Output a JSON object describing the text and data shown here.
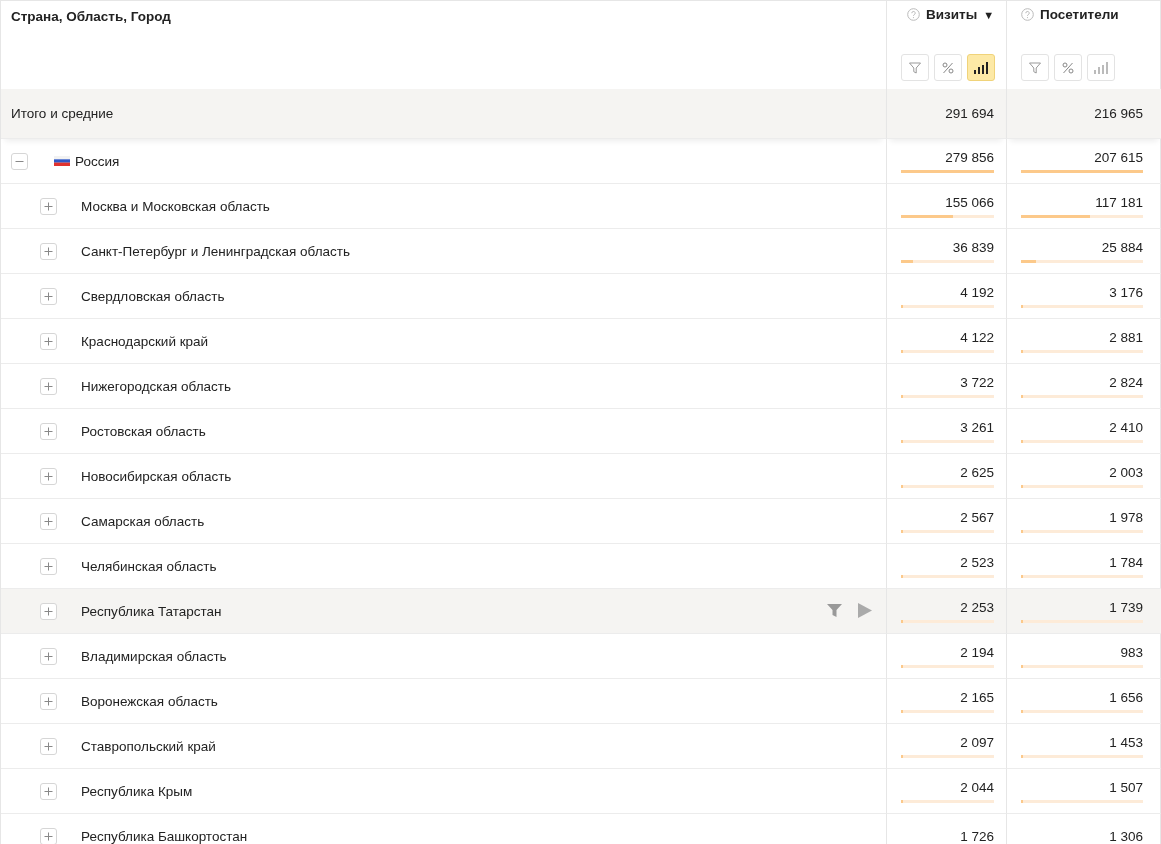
{
  "table": {
    "dimension_header": "Страна, Область, Город",
    "columns": [
      {
        "label": "Визиты",
        "sort_indicator": "▼",
        "tools": [
          {
            "kind": "filter",
            "selected": false
          },
          {
            "kind": "percent",
            "selected": false
          },
          {
            "kind": "bars",
            "selected": true
          }
        ]
      },
      {
        "label": "Посетители",
        "tools": [
          {
            "kind": "filter",
            "selected": false
          },
          {
            "kind": "percent",
            "selected": false
          },
          {
            "kind": "bars",
            "selected": false
          }
        ]
      }
    ],
    "totals": {
      "label": "Итого и средние",
      "values": [
        "291 694",
        "216 965"
      ]
    },
    "rows": [
      {
        "name": "Россия",
        "flag": true,
        "expanded": true,
        "hovered": false,
        "values": [
          {
            "text": "279 856",
            "level": 1
          },
          {
            "text": "207 615",
            "level": 1
          }
        ],
        "children": [
          {
            "name": "Москва и Московская область",
            "expanded": false,
            "hovered": false,
            "values": [
              {
                "text": "155 066",
                "level": 0.554
              },
              {
                "text": "117 181",
                "level": 0.564
              }
            ]
          },
          {
            "name": "Санкт-Петербург и Ленинградская область",
            "expanded": false,
            "hovered": false,
            "values": [
              {
                "text": "36 839",
                "level": 0.132
              },
              {
                "text": "25 884",
                "level": 0.125
              }
            ]
          },
          {
            "name": "Свердловская область",
            "expanded": false,
            "hovered": false,
            "values": [
              {
                "text": "4 192",
                "level": 0.015
              },
              {
                "text": "3 176",
                "level": 0.015
              }
            ]
          },
          {
            "name": "Краснодарский край",
            "expanded": false,
            "hovered": false,
            "values": [
              {
                "text": "4 122",
                "level": 0.015
              },
              {
                "text": "2 881",
                "level": 0.014
              }
            ]
          },
          {
            "name": "Нижегородская область",
            "expanded": false,
            "hovered": false,
            "values": [
              {
                "text": "3 722",
                "level": 0.013
              },
              {
                "text": "2 824",
                "level": 0.014
              }
            ]
          },
          {
            "name": "Ростовская область",
            "expanded": false,
            "hovered": false,
            "values": [
              {
                "text": "3 261",
                "level": 0.012
              },
              {
                "text": "2 410",
                "level": 0.012
              }
            ]
          },
          {
            "name": "Новосибирская область",
            "expanded": false,
            "hovered": false,
            "values": [
              {
                "text": "2 625",
                "level": 0.009
              },
              {
                "text": "2 003",
                "level": 0.01
              }
            ]
          },
          {
            "name": "Самарская область",
            "expanded": false,
            "hovered": false,
            "values": [
              {
                "text": "2 567",
                "level": 0.009
              },
              {
                "text": "1 978",
                "level": 0.01
              }
            ]
          },
          {
            "name": "Челябинская область",
            "expanded": false,
            "hovered": false,
            "values": [
              {
                "text": "2 523",
                "level": 0.009
              },
              {
                "text": "1 784",
                "level": 0.009
              }
            ]
          },
          {
            "name": "Республика Татарстан",
            "expanded": false,
            "hovered": true,
            "values": [
              {
                "text": "2 253",
                "level": 0.008
              },
              {
                "text": "1 739",
                "level": 0.008
              }
            ]
          },
          {
            "name": "Владимирская область",
            "expanded": false,
            "hovered": false,
            "values": [
              {
                "text": "2 194",
                "level": 0.008
              },
              {
                "text": "983",
                "level": 0.005
              }
            ]
          },
          {
            "name": "Воронежская область",
            "expanded": false,
            "hovered": false,
            "values": [
              {
                "text": "2 165",
                "level": 0.008
              },
              {
                "text": "1 656",
                "level": 0.008
              }
            ]
          },
          {
            "name": "Ставропольский край",
            "expanded": false,
            "hovered": false,
            "values": [
              {
                "text": "2 097",
                "level": 0.007
              },
              {
                "text": "1 453",
                "level": 0.007
              }
            ]
          },
          {
            "name": "Республика Крым",
            "expanded": false,
            "hovered": false,
            "values": [
              {
                "text": "2 044",
                "level": 0.007
              },
              {
                "text": "1 507",
                "level": 0.007
              }
            ]
          },
          {
            "name": "Республика Башкортостан",
            "expanded": false,
            "hovered": false,
            "values": [
              {
                "text": "1 726"
              },
              {
                "text": "1 306"
              }
            ]
          }
        ]
      }
    ]
  }
}
